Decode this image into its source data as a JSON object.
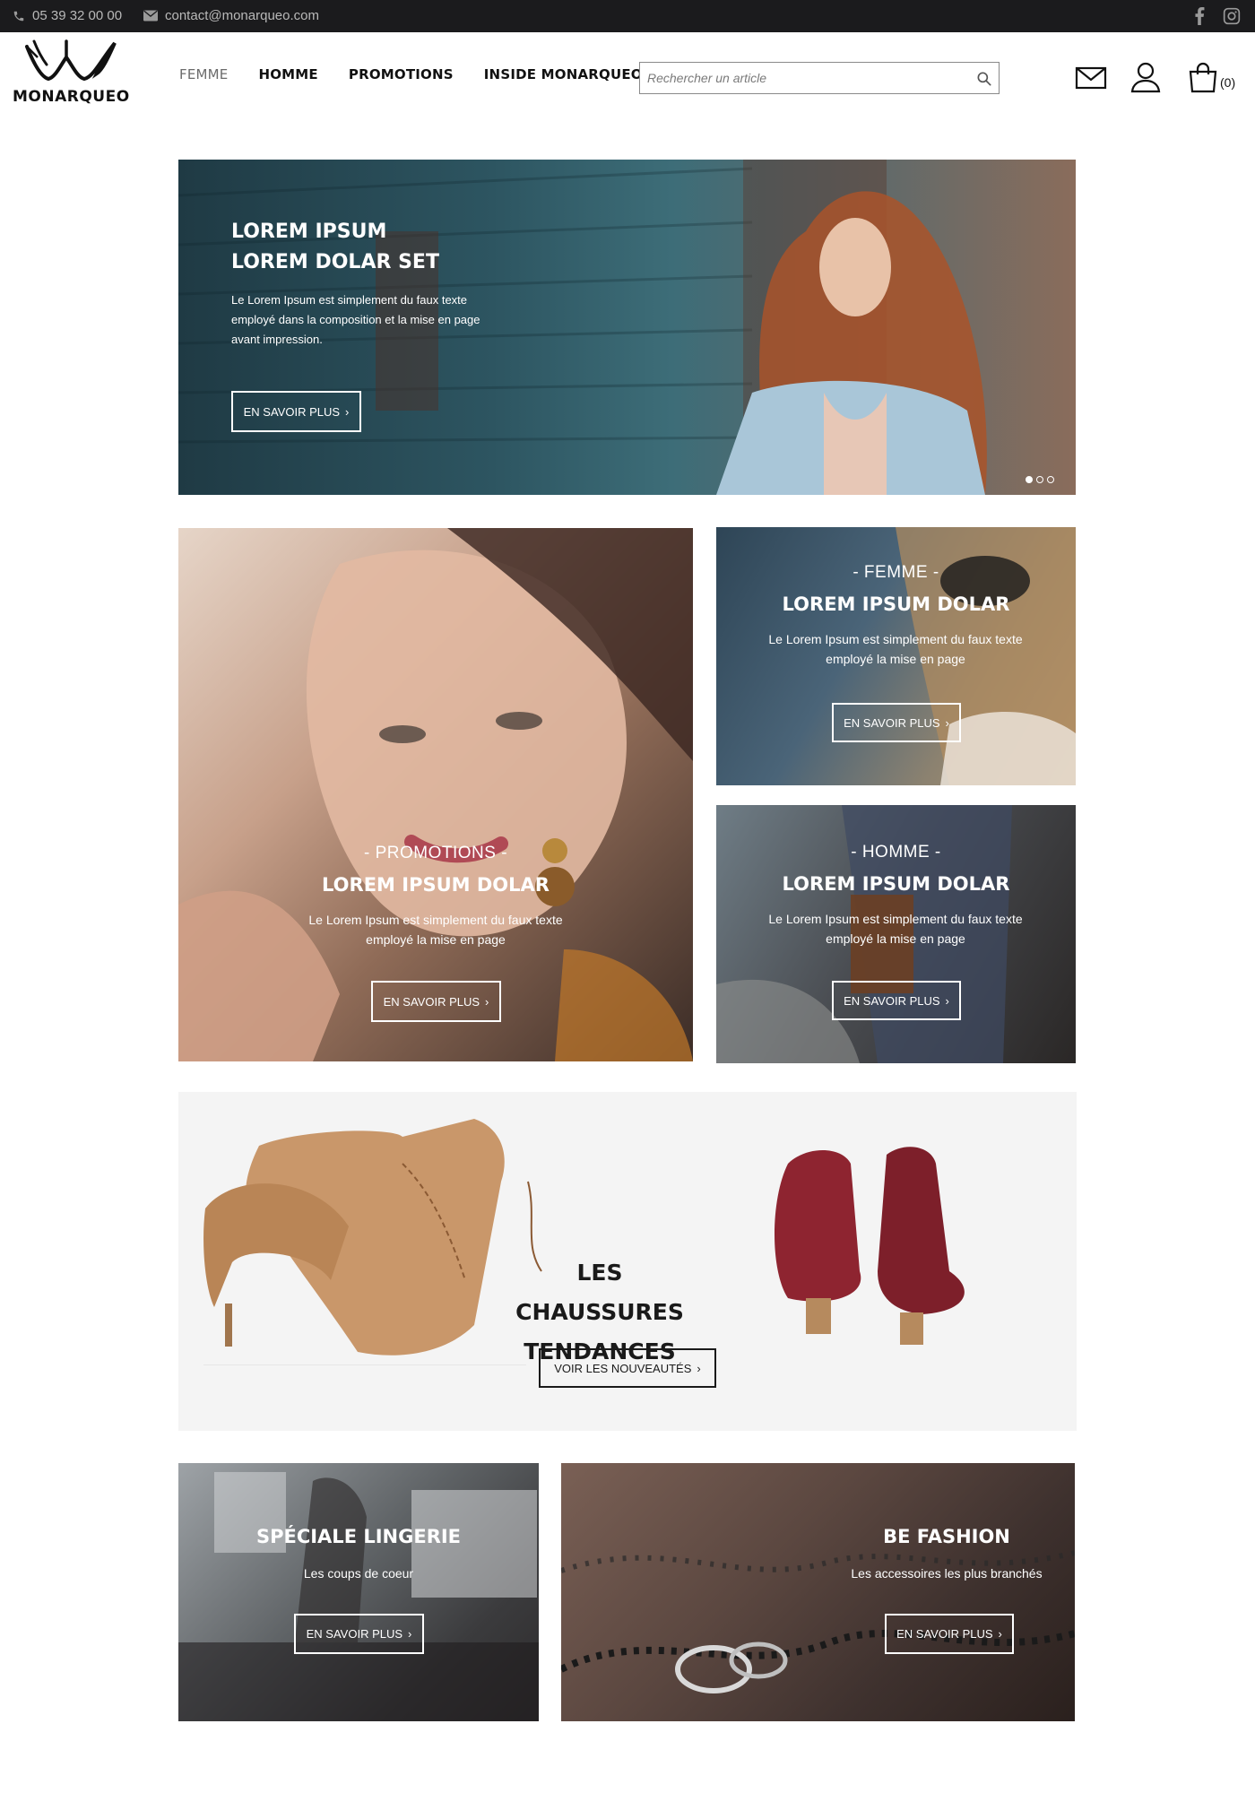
{
  "topbar": {
    "phone": "05 39 32 00 00",
    "email": "contact@monarqueo.com",
    "social": [
      "facebook-icon",
      "instagram-icon"
    ]
  },
  "header": {
    "logo_text": "MONARQUEO",
    "nav": [
      {
        "label": "FEMME",
        "active": false
      },
      {
        "label": "HOMME",
        "active": true
      },
      {
        "label": "PROMOTIONS",
        "active": true
      },
      {
        "label": "INSIDE MONARQUEO",
        "active": true
      }
    ],
    "search_placeholder": "Rechercher un article",
    "cart_count": "(0)"
  },
  "hero": {
    "title_line1": "LOREM IPSUM",
    "title_line2": "LOREM DOLAR SET",
    "text": "Le Lorem Ipsum est simplement du faux texte employé dans la composition et la mise en page avant impression.",
    "button": "EN SAVOIR PLUS",
    "slides": 3,
    "active_slide": 1
  },
  "promo": {
    "kicker": "- PROMOTIONS -",
    "title": "LOREM IPSUM DOLAR",
    "text": "Le Lorem Ipsum est simplement du faux texte employé la mise en page",
    "button": "EN SAVOIR PLUS"
  },
  "femme": {
    "kicker": "- FEMME -",
    "title": "LOREM IPSUM DOLAR",
    "text": "Le Lorem Ipsum est simplement du faux texte employé la mise en page",
    "button": "EN SAVOIR PLUS"
  },
  "homme": {
    "kicker": "- HOMME -",
    "title": "LOREM IPSUM DOLAR",
    "text": "Le Lorem Ipsum est simplement du faux texte employé la mise en page",
    "button": "EN SAVOIR PLUS"
  },
  "shoes": {
    "title_line1": "LES CHAUSSURES",
    "title_line2": "TENDANCES",
    "button": "VOIR LES NOUVEAUTÉS"
  },
  "lingerie": {
    "title": "SPÉCIALE LINGERIE",
    "subtitle": "Les coups de coeur",
    "button": "EN SAVOIR PLUS"
  },
  "fashion": {
    "title": "BE FASHION",
    "subtitle": "Les accessoires les plus branchés",
    "button": "EN SAVOIR PLUS"
  },
  "colors": {
    "topbar_bg": "#1b1b1d",
    "shoes_bg": "#f4f4f4",
    "boots_tan": "#c9976a",
    "booties_red": "#8e2430"
  }
}
